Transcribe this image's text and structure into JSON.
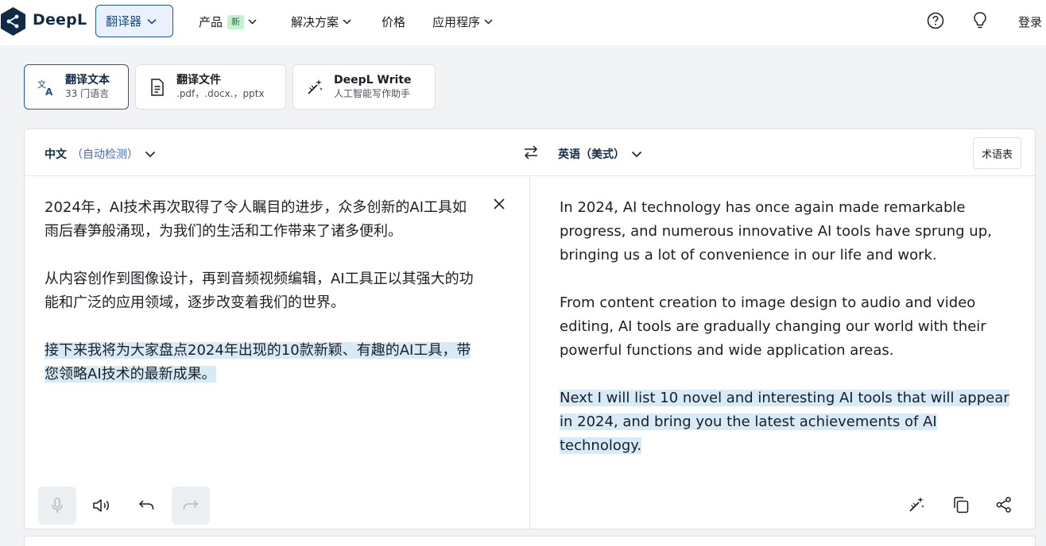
{
  "nav": {
    "brand": "DeepL",
    "translator_label": "翻译器",
    "items": [
      {
        "label": "产品",
        "badge": "新"
      },
      {
        "label": "解决方案"
      },
      {
        "label": "价格"
      },
      {
        "label": "应用程序"
      }
    ],
    "login": "登录"
  },
  "modes": [
    {
      "title": "翻译文本",
      "subtitle": "33 门语言",
      "icon": "translate-icon"
    },
    {
      "title": "翻译文件",
      "subtitle": ".pdf，.docx.，pptx",
      "icon": "document-icon"
    },
    {
      "title": "DeepL Write",
      "subtitle": "人工智能写作助手",
      "icon": "magic-wand-icon"
    }
  ],
  "source": {
    "language": "中文",
    "detect": "（自动检测）",
    "paragraphs": [
      "2024年，AI技术再次取得了令人瞩目的进步，众多创新的AI工具如雨后春笋般涌现，为我们的生活和工作带来了诸多便利。",
      "从内容创作到图像设计，再到音频视频编辑，AI工具正以其强大的功能和广泛的应用领域，逐步改变着我们的世界。",
      "接下来我将为大家盘点2024年出现的10款新颖、有趣的AI工具，带您领略AI技术的最新成果。"
    ]
  },
  "target": {
    "language": "英语（美式）",
    "glossary": "术语表",
    "paragraphs": [
      "In 2024, AI technology has once again made remarkable progress, and numerous innovative AI tools have sprung up, bringing us a lot of convenience in our life and work.",
      "From content creation to image design to audio and video editing, AI tools are gradually changing our world with their powerful functions and wide application areas.",
      "Next I will list 10 novel and interesting AI tools that will appear in 2024, and bring you the latest achievements of AI technology."
    ]
  },
  "colors": {
    "brand": "#0f2b46",
    "accent": "#1a5aa6",
    "highlight": "#d6eaf8",
    "new_badge": "#c5f0d2"
  }
}
